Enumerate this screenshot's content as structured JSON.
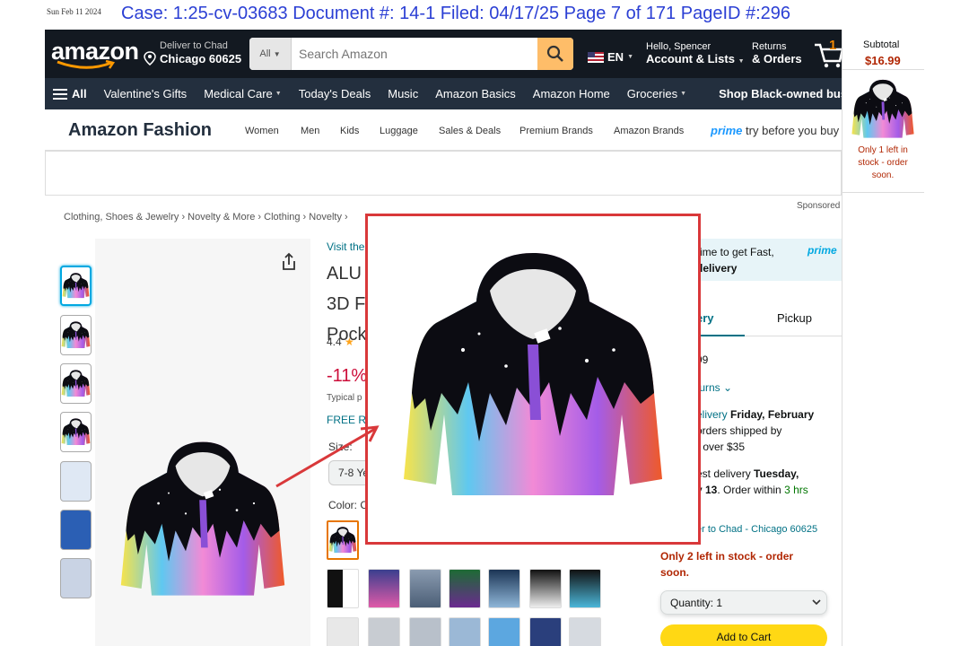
{
  "print": {
    "date": "Sun Feb 11 2024",
    "url": "Checkout Walk Through Amazon Fashion Hoodie Product Page"
  },
  "case_header": "Case: 1:25-cv-03683 Document #: 14-1 Filed: 04/17/25 Page 7 of 171 PageID #:296",
  "nav": {
    "logo": "amazon",
    "deliver_line1": "Deliver to Chad",
    "deliver_line2": "Chicago 60625",
    "search_category": "All",
    "search_placeholder": "Search Amazon",
    "language": "EN",
    "account_line1": "Hello, Spencer",
    "account_line2": "Account & Lists",
    "returns_line1": "Returns",
    "returns_line2": "& Orders",
    "cart_count": "1"
  },
  "subnav": {
    "all": "All",
    "items": [
      "Valentine's Gifts",
      "Medical Care",
      "Today's Deals",
      "Music",
      "Amazon Basics",
      "Amazon Home",
      "Groceries"
    ],
    "shop": "Shop Black-owned businesses"
  },
  "fashion": {
    "title": "Amazon Fashion",
    "links": [
      "Women",
      "Men",
      "Kids",
      "Luggage",
      "Sales & Deals",
      "Premium Brands",
      "Amazon Brands"
    ],
    "prime_word": "prime",
    "prime_tail": "try before you buy"
  },
  "sponsored": "Sponsored",
  "breadcrumb": "Clothing, Shoes & Jewelry › Novelty & More › Clothing › Novelty ›",
  "product": {
    "visit_link": "Visit the",
    "title_lines": [
      "ALU",
      "3D F",
      "Pock"
    ],
    "rating": "4.4",
    "discount": "-11%",
    "typical": "Typical p",
    "free_returns": "FREE Re",
    "size_label": "Size:",
    "size_value": "7-8 Ye",
    "color_label": "Color: C"
  },
  "buybox": {
    "prime_text_1": "rime to get Fast,",
    "prime_text_2": "delivery",
    "prime_logo": "prime",
    "tab_delivery": "ery",
    "tab_pickup": "Pickup",
    "price": "99",
    "returns": "turns",
    "delivery_1": "elivery",
    "delivery_1b": "Friday, February",
    "delivery_2": "orders shipped by",
    "delivery_3": "r over $35",
    "fast_1": "est delivery",
    "fast_1b": "Tuesday,",
    "fast_2": "y 13",
    "fast_2b": ". Order within",
    "fast_time": "3 hrs",
    "deliver_to": "er to Chad - Chicago 60625",
    "stock": "Only 2 left in stock - order soon.",
    "quantity": "Quantity:  1",
    "add_to_cart": "Add to Cart"
  },
  "panel": {
    "subtotal_label": "Subtotal",
    "subtotal": "$16.99",
    "stock": "Only 1 left in stock - order soon."
  }
}
